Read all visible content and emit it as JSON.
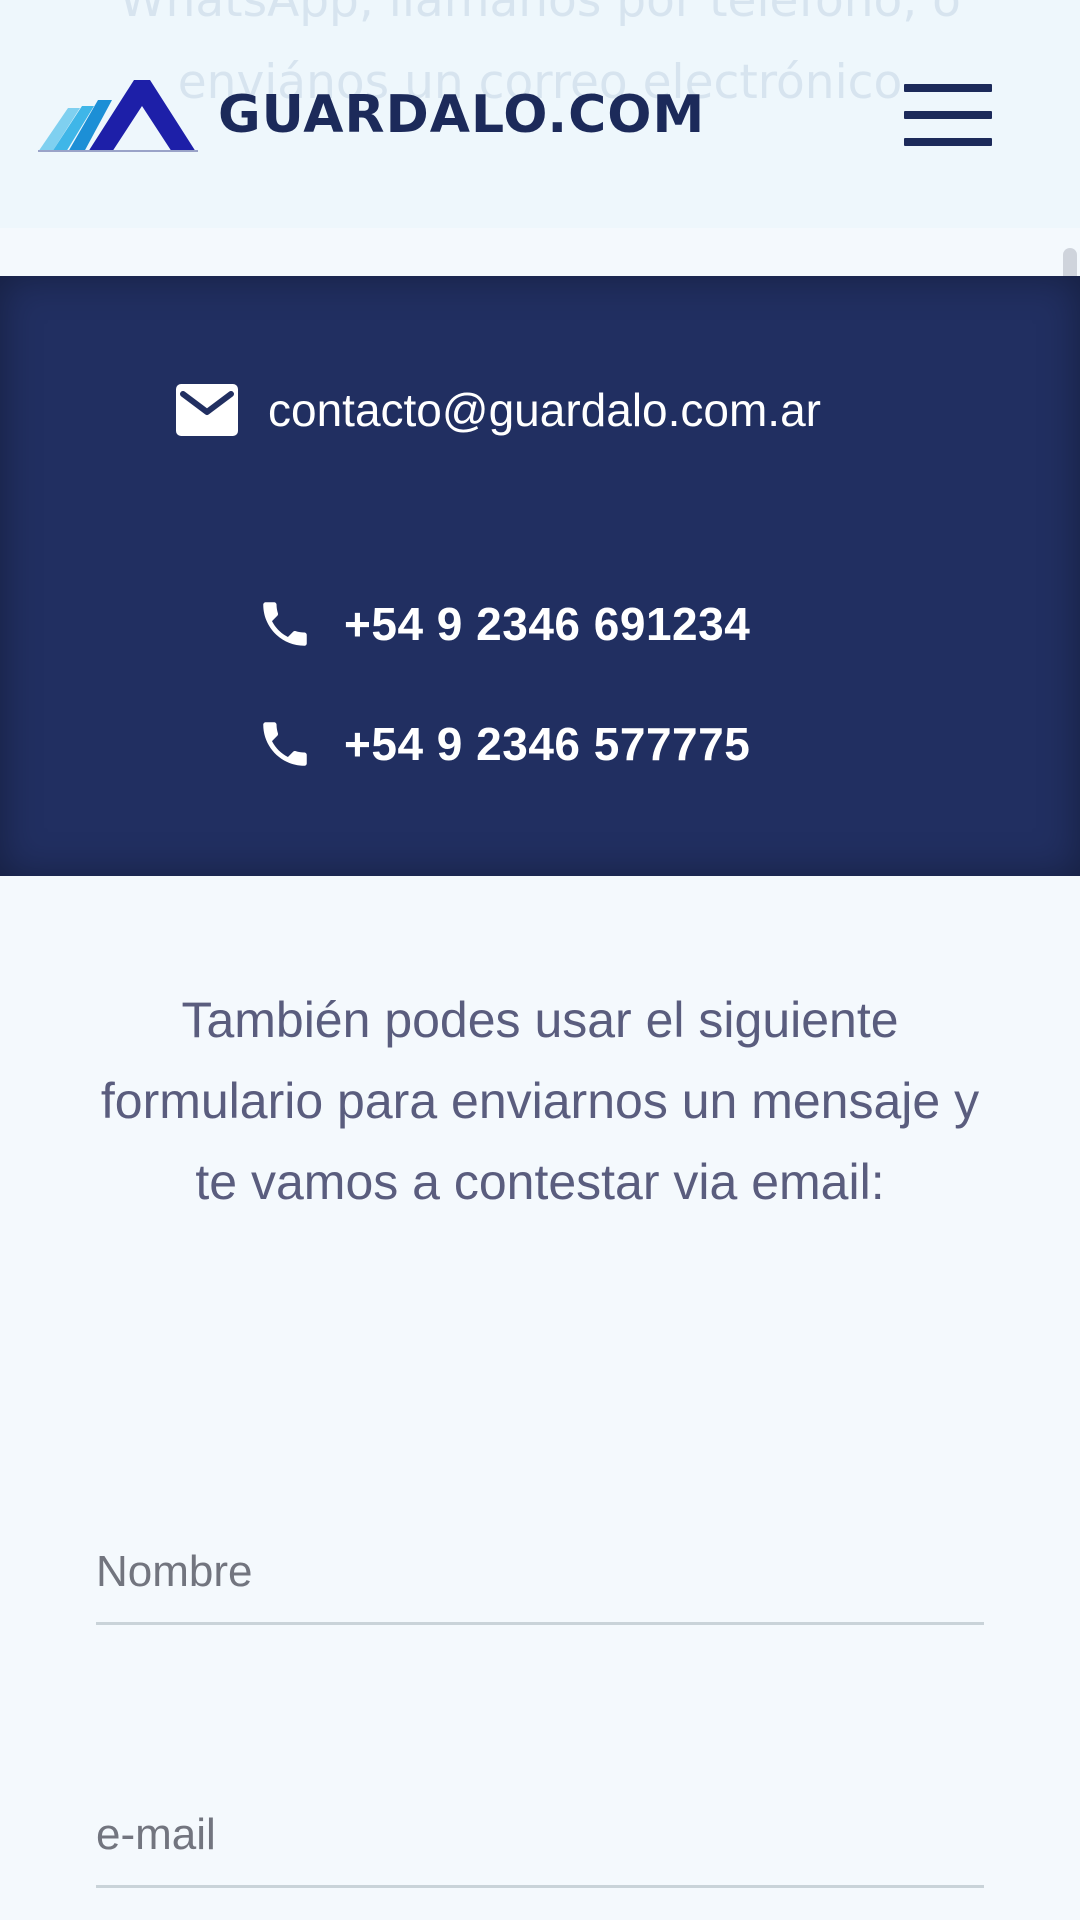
{
  "background": {
    "faded_text": "WhatsApp, llamános por teléfono, o\nenviános un correo electrónico"
  },
  "header": {
    "brand": "GUARDALO.COM",
    "icons": {
      "logo": "mountain-logo-icon",
      "menu": "hamburger-menu-icon"
    }
  },
  "contact": {
    "email": "contacto@guardalo.com.ar",
    "phones": [
      "+54 9 2346 691234",
      "+54 9 2346 577775"
    ],
    "icons": {
      "email": "envelope-icon",
      "phone": "phone-icon"
    }
  },
  "intro": {
    "text": "También podes usar el siguiente formulario para enviarnos un mensaje y te vamos a contestar via email:"
  },
  "form": {
    "nombre_placeholder": "Nombre",
    "email_placeholder": "e-mail"
  },
  "colors": {
    "brand_navy": "#1c2a5a",
    "panel_bg": "#212f61",
    "page_bg": "#f4f9fd",
    "logo_blue": "#1d1fa8",
    "logo_light_blue": "#3fb6e8"
  }
}
